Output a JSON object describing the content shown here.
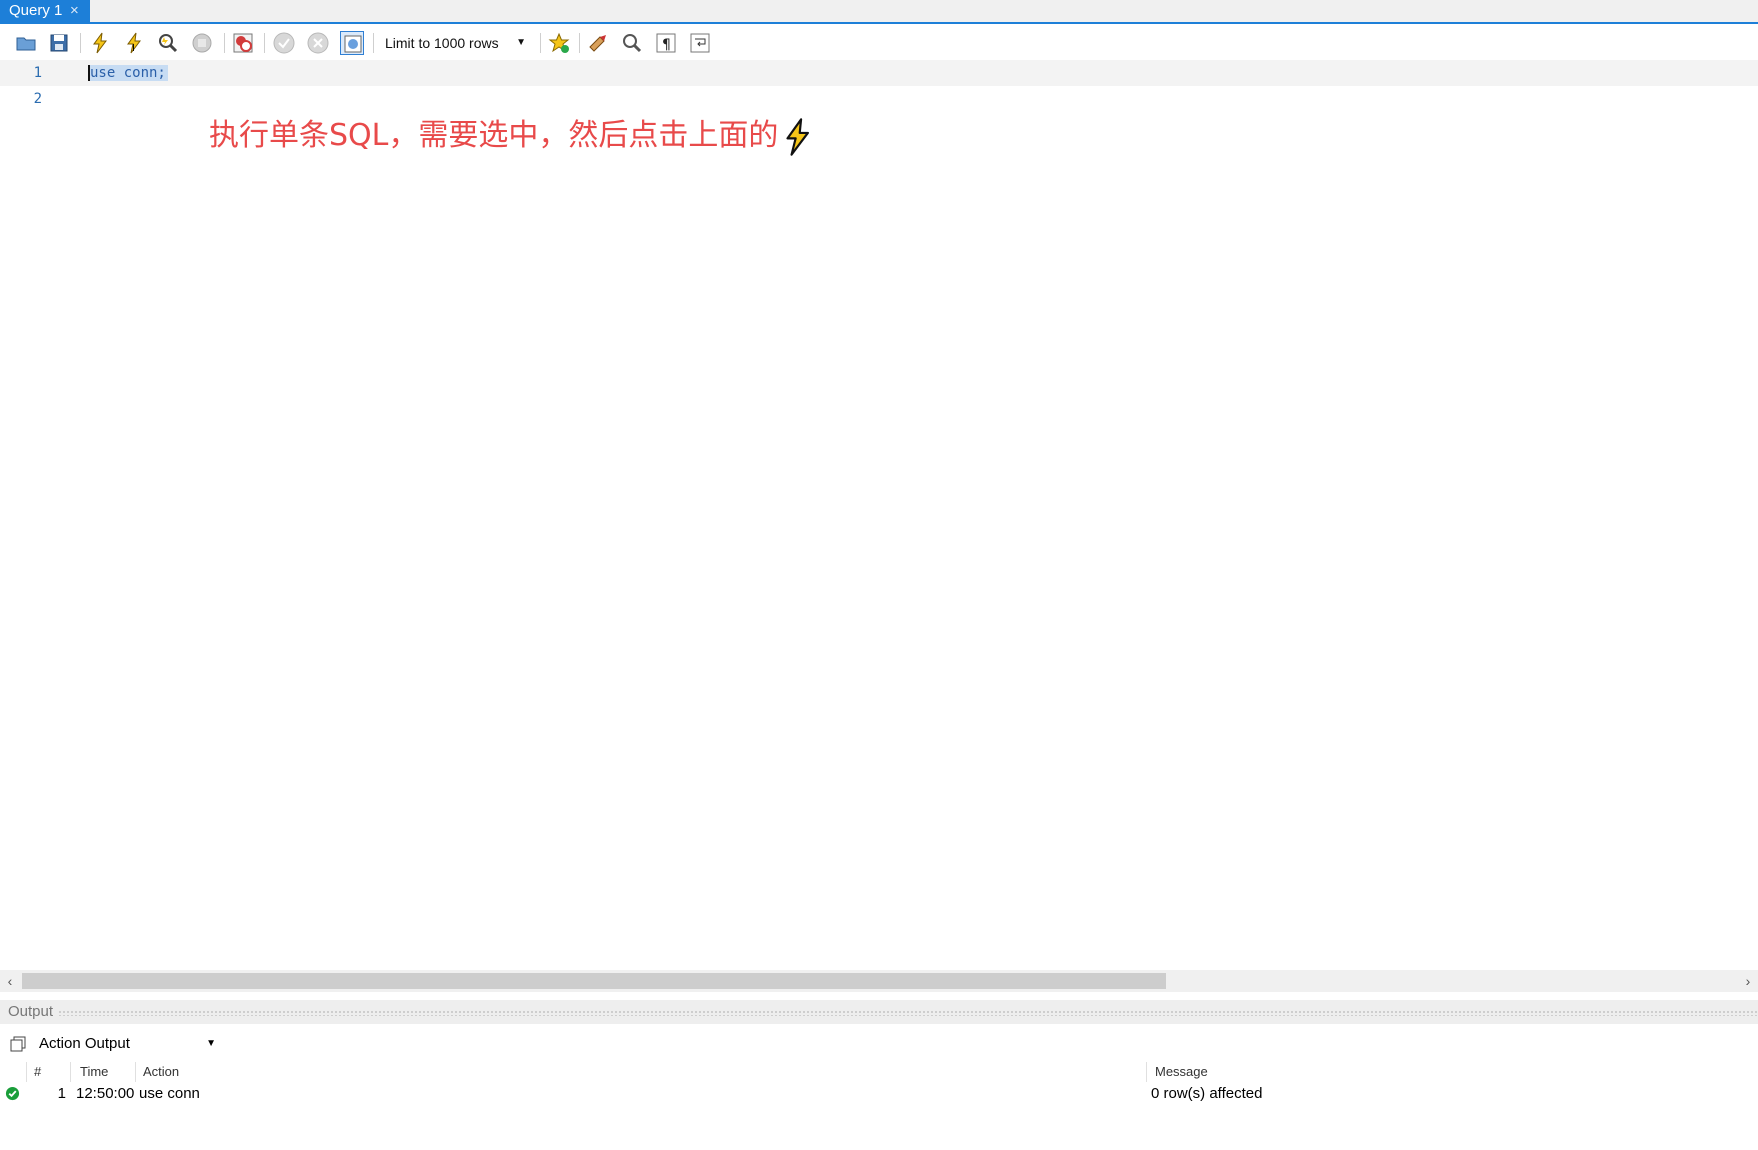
{
  "tab": {
    "label": "Query 1",
    "close_glyph": "×"
  },
  "toolbar": {
    "limit_select": "Limit to 1000 rows",
    "icons": [
      "open-file-icon",
      "save-icon",
      "execute-icon",
      "execute-current-icon",
      "explain-icon",
      "stop-icon",
      "stop-on-error-icon",
      "commit-icon",
      "rollback-icon",
      "autocommit-icon",
      "bookmark-icon",
      "beautify-icon",
      "find-icon",
      "invisible-chars-icon",
      "wrap-icon"
    ]
  },
  "editor": {
    "lines": [
      {
        "number": "1",
        "code": "use conn;"
      },
      {
        "number": "2",
        "code": ""
      }
    ],
    "annotation": "执行单条SQL，需要选中，然后点击上面的"
  },
  "output": {
    "title": "Output",
    "select_value": "Action Output",
    "columns": [
      "#",
      "Time",
      "Action",
      "Message"
    ],
    "rows": [
      {
        "index": "1",
        "time": "12:50:00",
        "action": "use conn",
        "message": "0 row(s) affected",
        "status": "success"
      }
    ]
  },
  "colors": {
    "accent": "#1d7fd8",
    "annotation": "#e84a4a",
    "success": "#1a9e3a"
  }
}
